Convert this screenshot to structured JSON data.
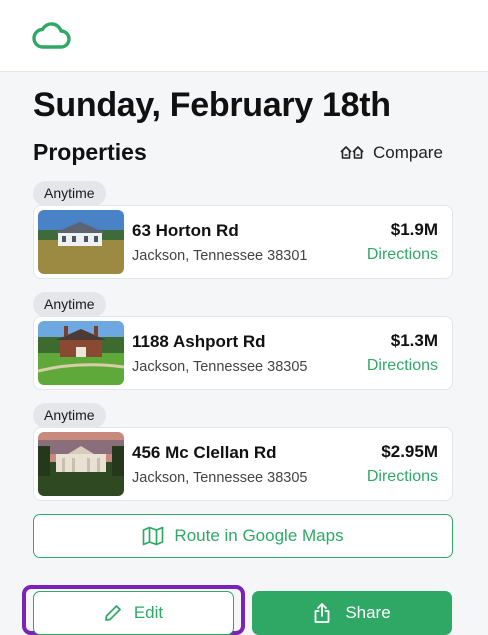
{
  "app": {
    "logo_icon": "cloud-icon",
    "accent_color": "#2fa866",
    "highlight_color": "#7b22b8"
  },
  "header": {
    "date_title": "Sunday, February 18th"
  },
  "properties_section": {
    "title": "Properties",
    "compare_label": "Compare",
    "compare_icon": "houses-icon"
  },
  "properties": [
    {
      "time_badge": "Anytime",
      "address": "63 Horton Rd",
      "city": "Jackson, Tennessee 38301",
      "price": "$1.9M",
      "directions_label": "Directions"
    },
    {
      "time_badge": "Anytime",
      "address": "1188 Ashport Rd",
      "city": "Jackson, Tennessee 38305",
      "price": "$1.3M",
      "directions_label": "Directions"
    },
    {
      "time_badge": "Anytime",
      "address": "456 Mc Clellan Rd",
      "city": "Jackson, Tennessee 38305",
      "price": "$2.95M",
      "directions_label": "Directions"
    }
  ],
  "actions": {
    "route_label": "Route in Google Maps",
    "route_icon": "map-icon",
    "edit_label": "Edit",
    "edit_icon": "pencil-icon",
    "share_label": "Share",
    "share_icon": "share-icon"
  }
}
